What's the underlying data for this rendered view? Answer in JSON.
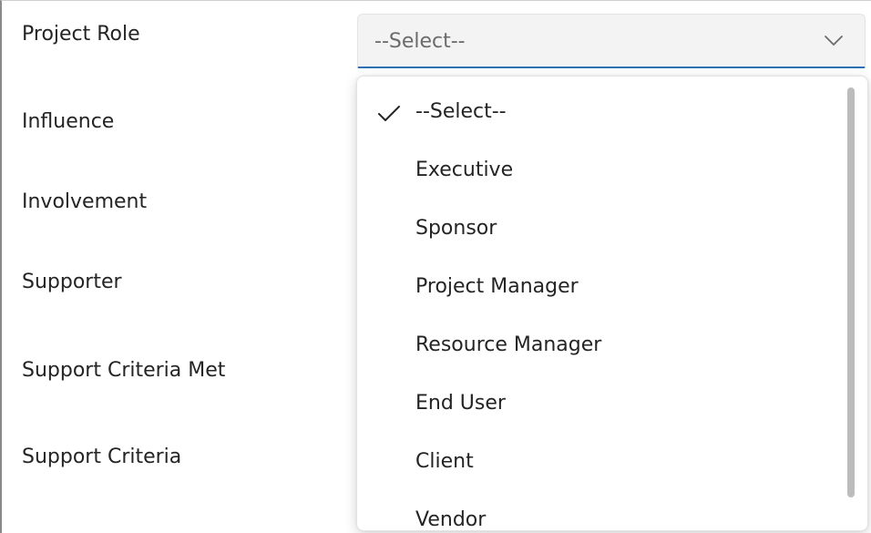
{
  "form": {
    "fields": [
      "Project Role",
      "Influence",
      "Involvement",
      "Supporter",
      "Support Criteria Met",
      "Support Criteria"
    ]
  },
  "project_role_select": {
    "value": "--Select--",
    "icon": "chevron-down-icon"
  },
  "dropdown": {
    "selected": "--Select--",
    "options": [
      "--Select--",
      "Executive",
      "Sponsor",
      "Project Manager",
      "Resource Manager",
      "End User",
      "Client",
      "Vendor"
    ],
    "check_icon": "checkmark-icon"
  },
  "colors": {
    "accent": "#2f6fb6",
    "select_background": "#f3f3f3",
    "text": "#242424",
    "placeholder_text": "#6b6b6b",
    "scrollbar": "#bcbcbc"
  }
}
